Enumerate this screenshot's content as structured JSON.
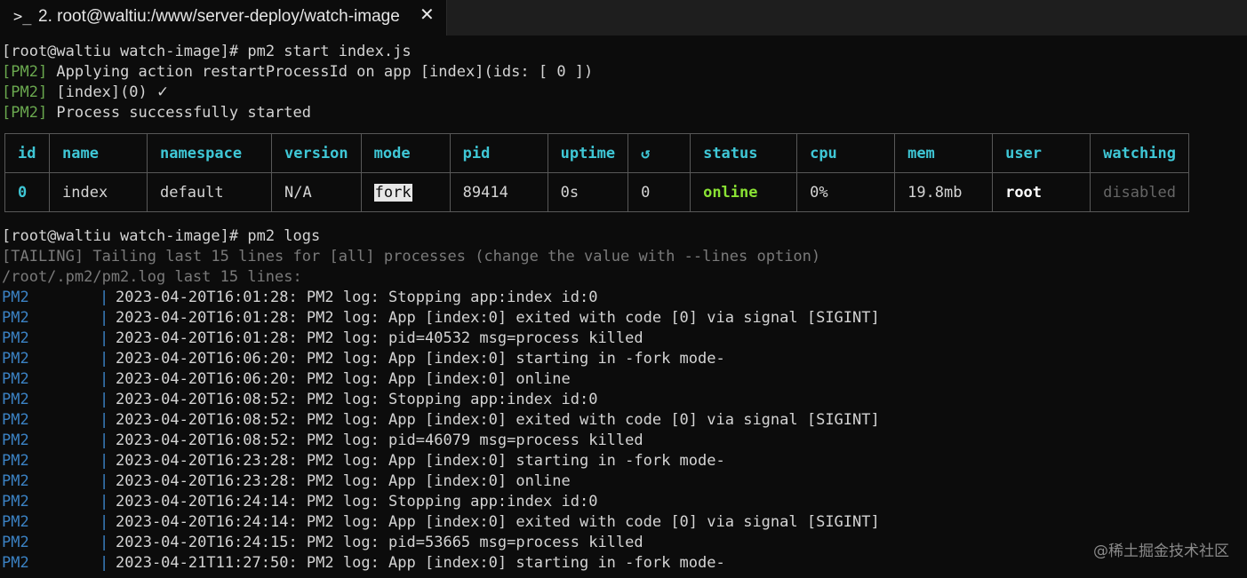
{
  "tab": {
    "icon": ">_",
    "title": "2. root@waltiu:/www/server-deploy/watch-image",
    "close": "✕"
  },
  "session": {
    "prompt1": "[root@waltiu watch-image]# ",
    "cmd1": "pm2 start index.js",
    "pm2_tag": "[PM2]",
    "msg1": " Applying action restartProcessId on app [index](ids: [ 0 ])",
    "msg2": " [index](0) ",
    "msg2_check": "✓",
    "msg3": " Process successfully started",
    "prompt2": "[root@waltiu watch-image]# ",
    "cmd2": "pm2 logs",
    "tailing": "[TAILING] Tailing last 15 lines for [all] processes (change the value with --lines option)",
    "logpath": "/root/.pm2/pm2.log last 15 lines:"
  },
  "table": {
    "headers": [
      "id",
      "name",
      "namespace",
      "version",
      "mode",
      "pid",
      "uptime",
      "↺",
      "status",
      "cpu",
      "mem",
      "user",
      "watching"
    ],
    "row": {
      "id": "0",
      "name": "index",
      "namespace": "default",
      "version": "N/A",
      "mode": "fork",
      "pid": "89414",
      "uptime": "0s",
      "restarts": "0",
      "status": "online",
      "cpu": "0%",
      "mem": "19.8mb",
      "user": "root",
      "watching": "disabled"
    }
  },
  "logs": [
    {
      "src": "PM2",
      "msg": "2023-04-20T16:01:28: PM2 log: Stopping app:index id:0"
    },
    {
      "src": "PM2",
      "msg": "2023-04-20T16:01:28: PM2 log: App [index:0] exited with code [0] via signal [SIGINT]"
    },
    {
      "src": "PM2",
      "msg": "2023-04-20T16:01:28: PM2 log: pid=40532 msg=process killed"
    },
    {
      "src": "PM2",
      "msg": "2023-04-20T16:06:20: PM2 log: App [index:0] starting in -fork mode-"
    },
    {
      "src": "PM2",
      "msg": "2023-04-20T16:06:20: PM2 log: App [index:0] online"
    },
    {
      "src": "PM2",
      "msg": "2023-04-20T16:08:52: PM2 log: Stopping app:index id:0"
    },
    {
      "src": "PM2",
      "msg": "2023-04-20T16:08:52: PM2 log: App [index:0] exited with code [0] via signal [SIGINT]"
    },
    {
      "src": "PM2",
      "msg": "2023-04-20T16:08:52: PM2 log: pid=46079 msg=process killed"
    },
    {
      "src": "PM2",
      "msg": "2023-04-20T16:23:28: PM2 log: App [index:0] starting in -fork mode-"
    },
    {
      "src": "PM2",
      "msg": "2023-04-20T16:23:28: PM2 log: App [index:0] online"
    },
    {
      "src": "PM2",
      "msg": "2023-04-20T16:24:14: PM2 log: Stopping app:index id:0"
    },
    {
      "src": "PM2",
      "msg": "2023-04-20T16:24:14: PM2 log: App [index:0] exited with code [0] via signal [SIGINT]"
    },
    {
      "src": "PM2",
      "msg": "2023-04-20T16:24:15: PM2 log: pid=53665 msg=process killed"
    },
    {
      "src": "PM2",
      "msg": "2023-04-21T11:27:50: PM2 log: App [index:0] starting in -fork mode-"
    }
  ],
  "watermark": "@稀土掘金技术社区"
}
